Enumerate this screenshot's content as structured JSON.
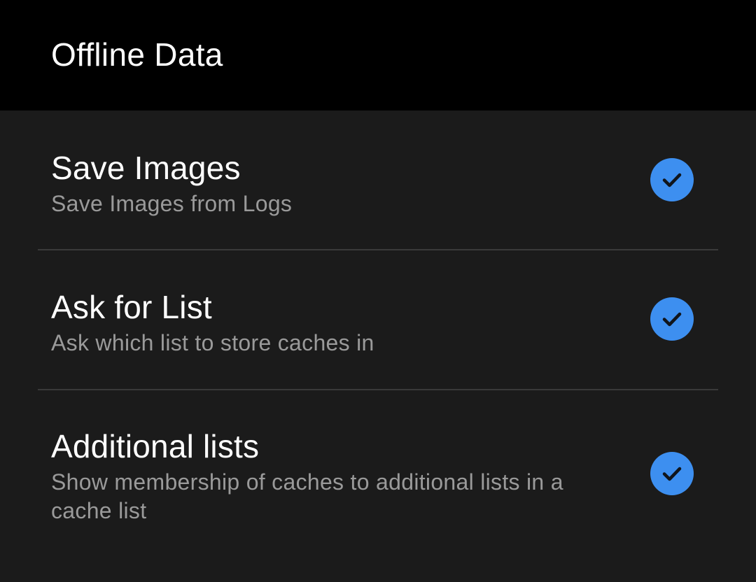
{
  "header": {
    "title": "Offline Data"
  },
  "preferences": [
    {
      "title": "Save Images",
      "summary": "Save Images from Logs",
      "checked": true
    },
    {
      "title": "Ask for List",
      "summary": "Ask which list to store caches in",
      "checked": true
    },
    {
      "title": "Additional lists",
      "summary": "Show membership of caches to additional lists in a cache list",
      "checked": true
    }
  ],
  "colors": {
    "accent": "#3d8ff0",
    "background": "#1b1b1b",
    "header_background": "#000000",
    "title_text": "#ffffff",
    "summary_text": "#9a9a9a",
    "divider": "#3a3a3a"
  },
  "icons": {
    "checkbox": "check-circle-icon"
  }
}
